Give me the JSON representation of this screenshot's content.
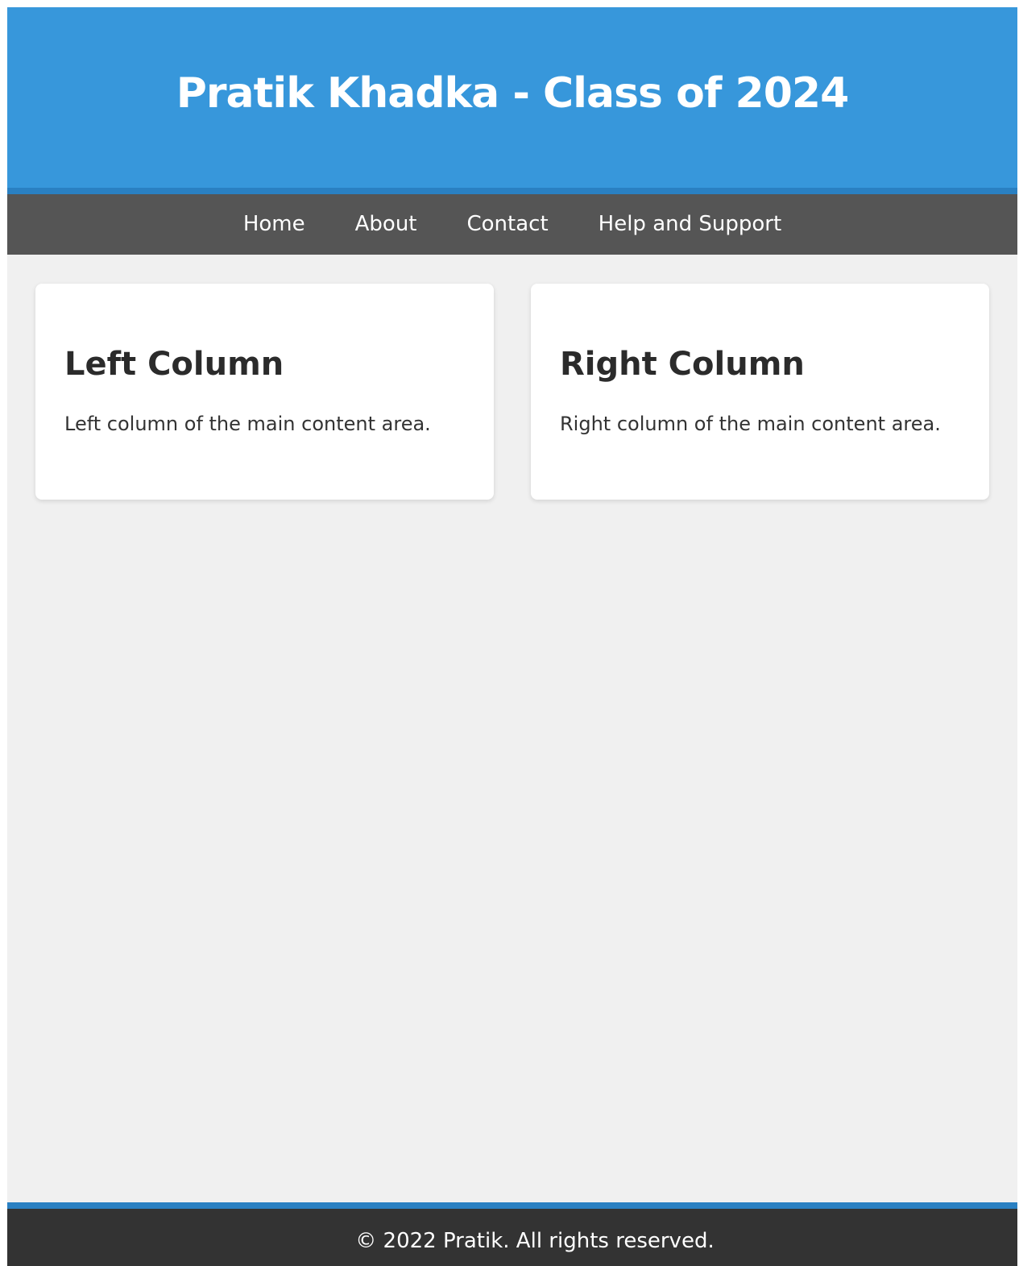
{
  "header": {
    "title": "Pratik Khadka - Class of 2024"
  },
  "nav": {
    "items": [
      {
        "label": "Home"
      },
      {
        "label": "About"
      },
      {
        "label": "Contact"
      },
      {
        "label": "Help and Support"
      }
    ]
  },
  "main": {
    "left": {
      "heading": "Left Column",
      "text": "Left column of the main content area."
    },
    "right": {
      "heading": "Right Column",
      "text": "Right column of the main content area."
    }
  },
  "footer": {
    "text": "© 2022 Pratik. All rights reserved."
  },
  "colors": {
    "header_bg": "#3797db",
    "accent_border": "#2a80c2",
    "nav_bg": "#555555",
    "footer_bg": "#333333",
    "page_bg": "#f0f0f0"
  }
}
